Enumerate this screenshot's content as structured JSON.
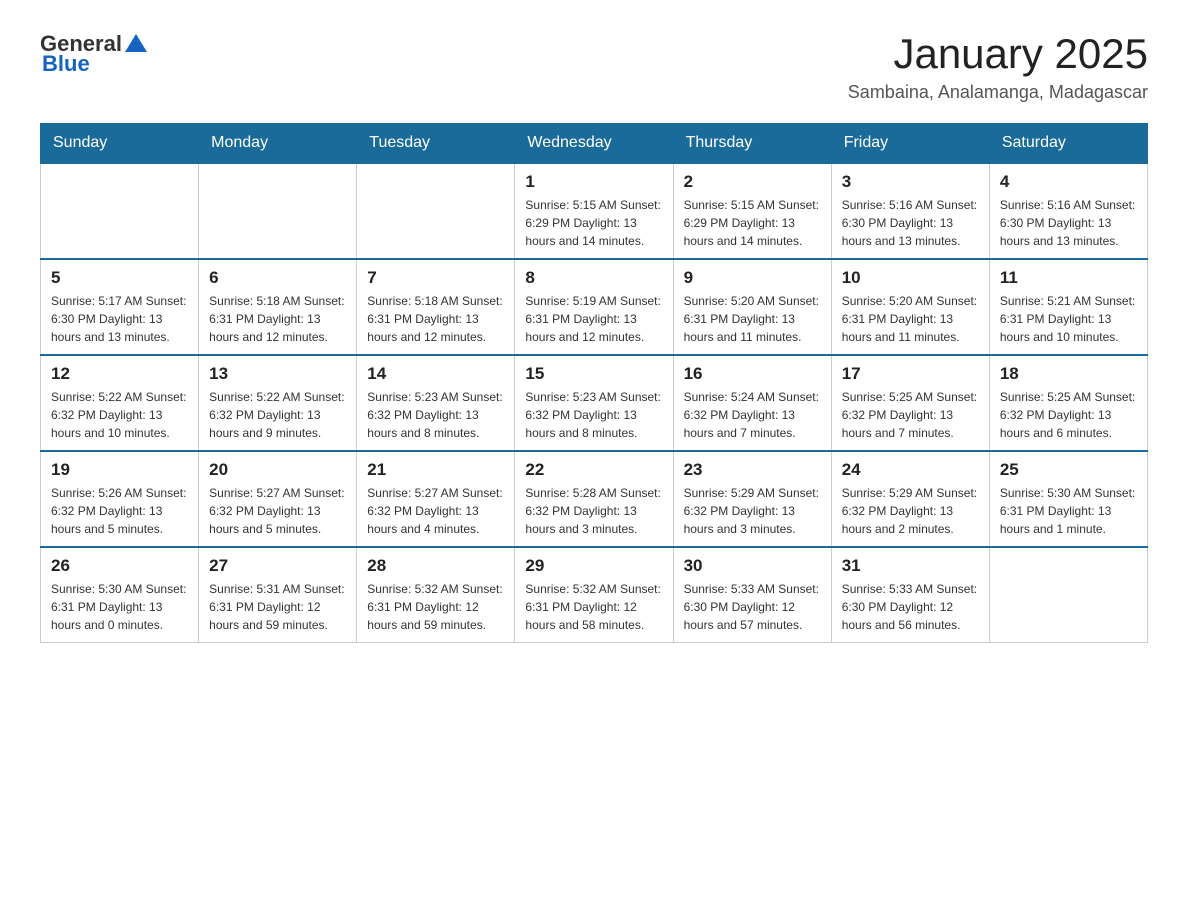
{
  "header": {
    "logo_general": "General",
    "logo_blue": "Blue",
    "title": "January 2025",
    "subtitle": "Sambaina, Analamanga, Madagascar"
  },
  "weekdays": [
    "Sunday",
    "Monday",
    "Tuesday",
    "Wednesday",
    "Thursday",
    "Friday",
    "Saturday"
  ],
  "weeks": [
    [
      {
        "day": "",
        "info": ""
      },
      {
        "day": "",
        "info": ""
      },
      {
        "day": "",
        "info": ""
      },
      {
        "day": "1",
        "info": "Sunrise: 5:15 AM\nSunset: 6:29 PM\nDaylight: 13 hours\nand 14 minutes."
      },
      {
        "day": "2",
        "info": "Sunrise: 5:15 AM\nSunset: 6:29 PM\nDaylight: 13 hours\nand 14 minutes."
      },
      {
        "day": "3",
        "info": "Sunrise: 5:16 AM\nSunset: 6:30 PM\nDaylight: 13 hours\nand 13 minutes."
      },
      {
        "day": "4",
        "info": "Sunrise: 5:16 AM\nSunset: 6:30 PM\nDaylight: 13 hours\nand 13 minutes."
      }
    ],
    [
      {
        "day": "5",
        "info": "Sunrise: 5:17 AM\nSunset: 6:30 PM\nDaylight: 13 hours\nand 13 minutes."
      },
      {
        "day": "6",
        "info": "Sunrise: 5:18 AM\nSunset: 6:31 PM\nDaylight: 13 hours\nand 12 minutes."
      },
      {
        "day": "7",
        "info": "Sunrise: 5:18 AM\nSunset: 6:31 PM\nDaylight: 13 hours\nand 12 minutes."
      },
      {
        "day": "8",
        "info": "Sunrise: 5:19 AM\nSunset: 6:31 PM\nDaylight: 13 hours\nand 12 minutes."
      },
      {
        "day": "9",
        "info": "Sunrise: 5:20 AM\nSunset: 6:31 PM\nDaylight: 13 hours\nand 11 minutes."
      },
      {
        "day": "10",
        "info": "Sunrise: 5:20 AM\nSunset: 6:31 PM\nDaylight: 13 hours\nand 11 minutes."
      },
      {
        "day": "11",
        "info": "Sunrise: 5:21 AM\nSunset: 6:31 PM\nDaylight: 13 hours\nand 10 minutes."
      }
    ],
    [
      {
        "day": "12",
        "info": "Sunrise: 5:22 AM\nSunset: 6:32 PM\nDaylight: 13 hours\nand 10 minutes."
      },
      {
        "day": "13",
        "info": "Sunrise: 5:22 AM\nSunset: 6:32 PM\nDaylight: 13 hours\nand 9 minutes."
      },
      {
        "day": "14",
        "info": "Sunrise: 5:23 AM\nSunset: 6:32 PM\nDaylight: 13 hours\nand 8 minutes."
      },
      {
        "day": "15",
        "info": "Sunrise: 5:23 AM\nSunset: 6:32 PM\nDaylight: 13 hours\nand 8 minutes."
      },
      {
        "day": "16",
        "info": "Sunrise: 5:24 AM\nSunset: 6:32 PM\nDaylight: 13 hours\nand 7 minutes."
      },
      {
        "day": "17",
        "info": "Sunrise: 5:25 AM\nSunset: 6:32 PM\nDaylight: 13 hours\nand 7 minutes."
      },
      {
        "day": "18",
        "info": "Sunrise: 5:25 AM\nSunset: 6:32 PM\nDaylight: 13 hours\nand 6 minutes."
      }
    ],
    [
      {
        "day": "19",
        "info": "Sunrise: 5:26 AM\nSunset: 6:32 PM\nDaylight: 13 hours\nand 5 minutes."
      },
      {
        "day": "20",
        "info": "Sunrise: 5:27 AM\nSunset: 6:32 PM\nDaylight: 13 hours\nand 5 minutes."
      },
      {
        "day": "21",
        "info": "Sunrise: 5:27 AM\nSunset: 6:32 PM\nDaylight: 13 hours\nand 4 minutes."
      },
      {
        "day": "22",
        "info": "Sunrise: 5:28 AM\nSunset: 6:32 PM\nDaylight: 13 hours\nand 3 minutes."
      },
      {
        "day": "23",
        "info": "Sunrise: 5:29 AM\nSunset: 6:32 PM\nDaylight: 13 hours\nand 3 minutes."
      },
      {
        "day": "24",
        "info": "Sunrise: 5:29 AM\nSunset: 6:32 PM\nDaylight: 13 hours\nand 2 minutes."
      },
      {
        "day": "25",
        "info": "Sunrise: 5:30 AM\nSunset: 6:31 PM\nDaylight: 13 hours\nand 1 minute."
      }
    ],
    [
      {
        "day": "26",
        "info": "Sunrise: 5:30 AM\nSunset: 6:31 PM\nDaylight: 13 hours\nand 0 minutes."
      },
      {
        "day": "27",
        "info": "Sunrise: 5:31 AM\nSunset: 6:31 PM\nDaylight: 12 hours\nand 59 minutes."
      },
      {
        "day": "28",
        "info": "Sunrise: 5:32 AM\nSunset: 6:31 PM\nDaylight: 12 hours\nand 59 minutes."
      },
      {
        "day": "29",
        "info": "Sunrise: 5:32 AM\nSunset: 6:31 PM\nDaylight: 12 hours\nand 58 minutes."
      },
      {
        "day": "30",
        "info": "Sunrise: 5:33 AM\nSunset: 6:30 PM\nDaylight: 12 hours\nand 57 minutes."
      },
      {
        "day": "31",
        "info": "Sunrise: 5:33 AM\nSunset: 6:30 PM\nDaylight: 12 hours\nand 56 minutes."
      },
      {
        "day": "",
        "info": ""
      }
    ]
  ]
}
